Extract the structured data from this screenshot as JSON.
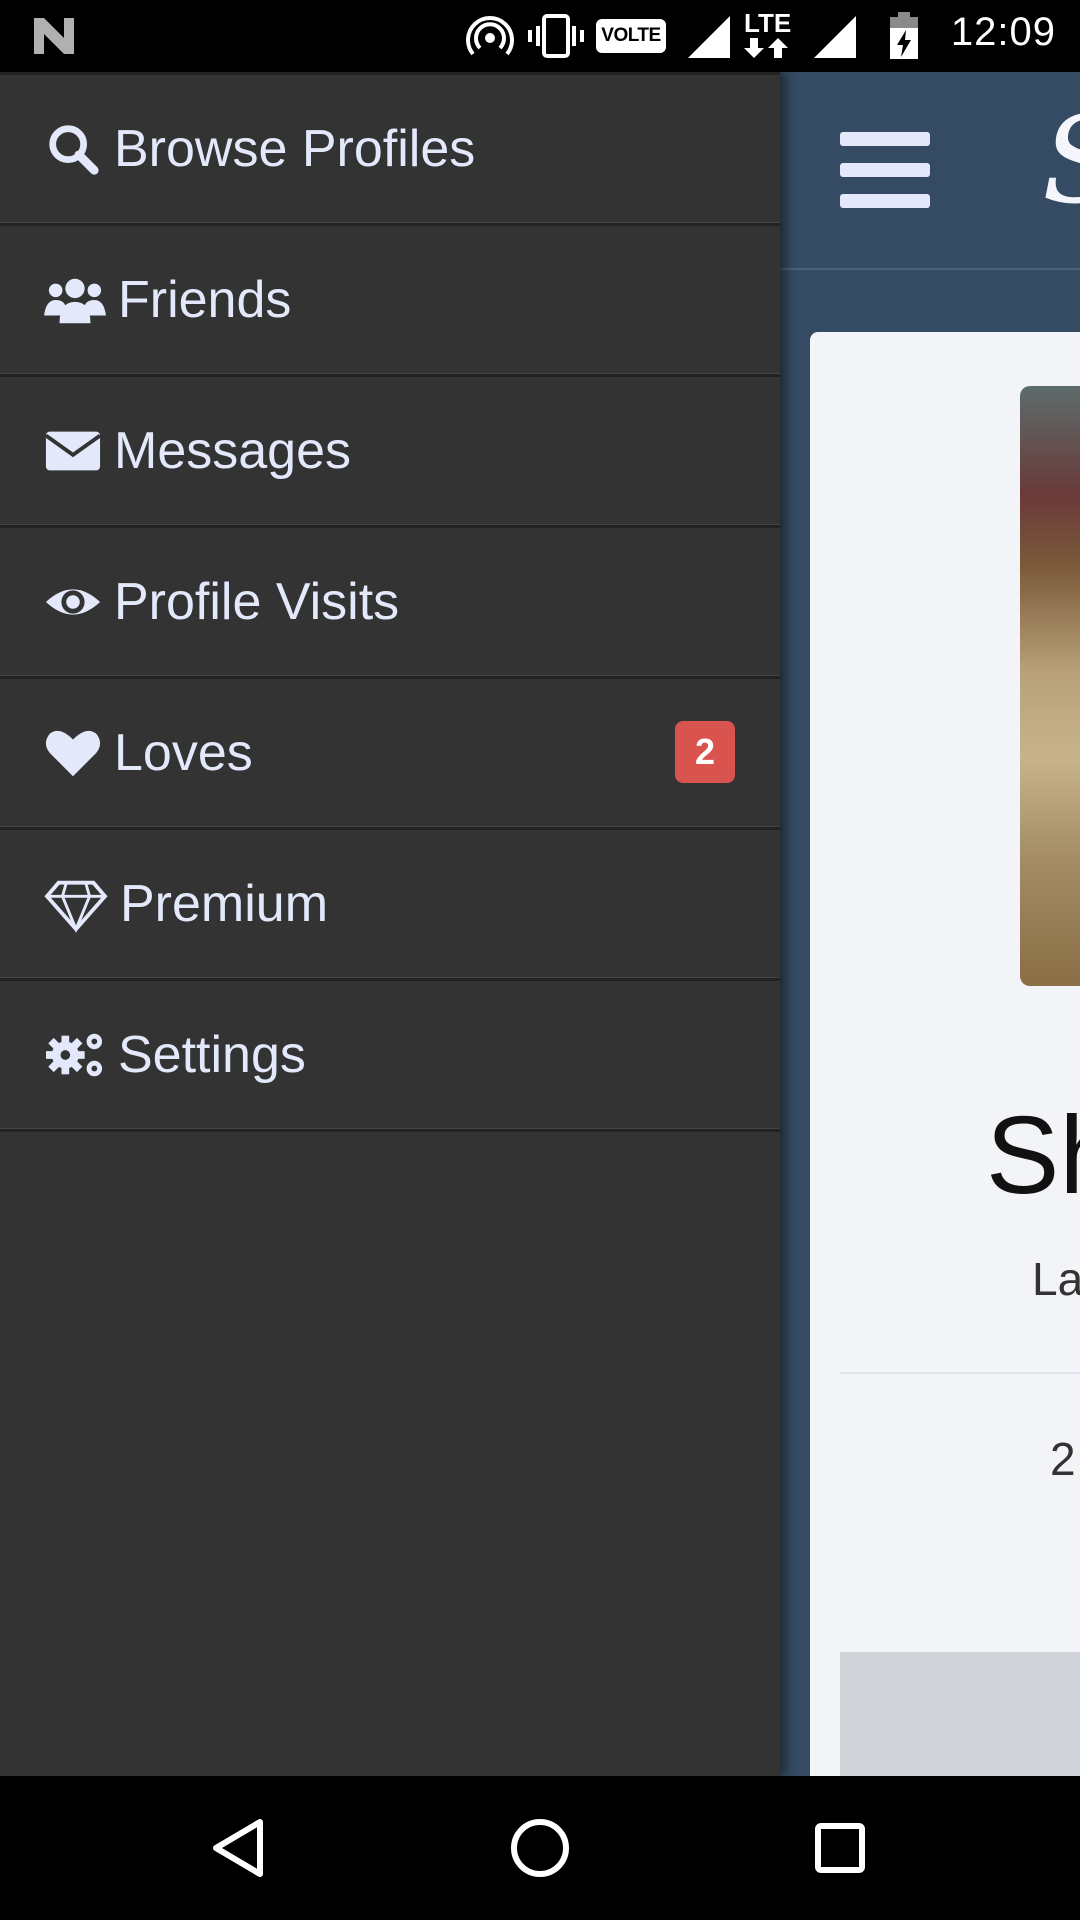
{
  "status_bar": {
    "time": "12:09",
    "volte_label": "VOLTE",
    "lte_label": "LTE",
    "icons": [
      "n-logo-icon",
      "hotspot-icon",
      "vibrate-icon",
      "signal-icon",
      "battery-charging-icon"
    ]
  },
  "drawer": {
    "items": [
      {
        "label": "Browse Profiles",
        "icon": "search-icon"
      },
      {
        "label": "Friends",
        "icon": "users-icon"
      },
      {
        "label": "Messages",
        "icon": "envelope-icon"
      },
      {
        "label": "Profile Visits",
        "icon": "eye-icon"
      },
      {
        "label": "Loves",
        "icon": "heart-icon",
        "badge": "2"
      },
      {
        "label": "Premium",
        "icon": "diamond-icon"
      },
      {
        "label": "Settings",
        "icon": "gears-icon"
      }
    ],
    "badge_color": "#d9534f",
    "text_color": "#e3e9fb",
    "background": "#333333"
  },
  "app": {
    "header_bg": "#354b63",
    "logo_char": "S",
    "profile_name_partial": "Sh",
    "profile_sub_partial": "La",
    "profile_number_partial": "2"
  },
  "navbar": {
    "buttons": [
      "back-icon",
      "home-icon",
      "recents-icon"
    ]
  }
}
